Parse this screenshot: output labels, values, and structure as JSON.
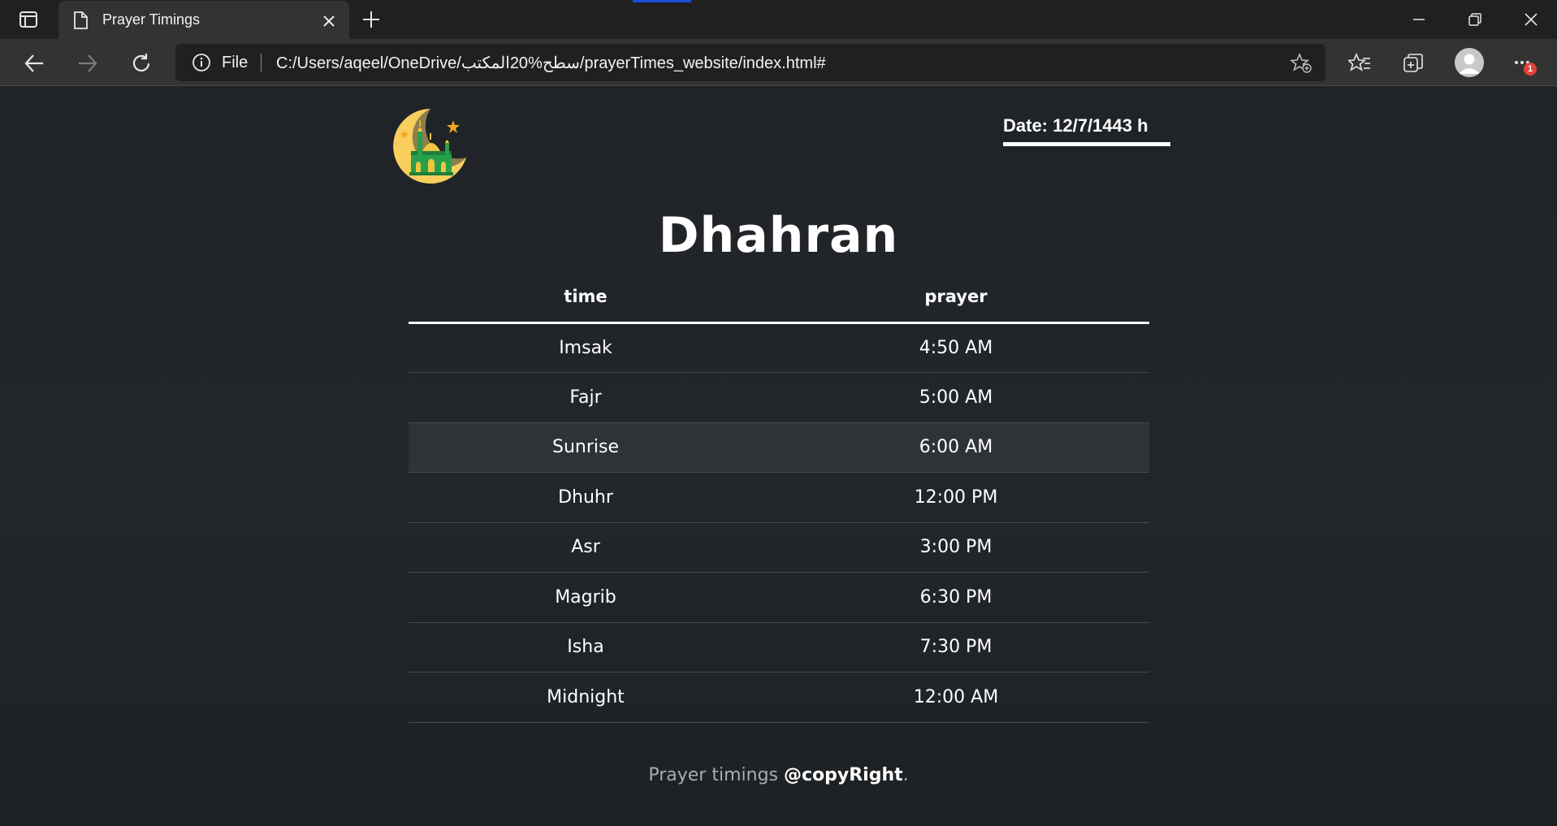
{
  "browser": {
    "tab_title": "Prayer Timings",
    "address_scheme": "File",
    "address_url": "C:/Users/aqeel/OneDrive/سطح%20المكتب/prayerTimes_website/index.html#",
    "menu_badge": "1"
  },
  "page": {
    "date_label": "Date: 12/7/1443 h",
    "city": "Dhahran",
    "table": {
      "headers": [
        "time",
        "prayer"
      ],
      "rows": [
        [
          "Imsak",
          "4:50 AM"
        ],
        [
          "Fajr",
          "5:00 AM"
        ],
        [
          "Sunrise",
          "6:00 AM"
        ],
        [
          "Dhuhr",
          "12:00 PM"
        ],
        [
          "Asr",
          "3:00 PM"
        ],
        [
          "Magrib",
          "6:30 PM"
        ],
        [
          "Isha",
          "7:30 PM"
        ],
        [
          "Midnight",
          "12:00 AM"
        ]
      ]
    },
    "footer_text": "Prayer timings ",
    "footer_bold": "@copyRight",
    "footer_end": "."
  },
  "icons": {
    "tab_actions": "tab-actions-icon",
    "page": "page-icon",
    "close": "close-icon",
    "new_tab": "plus-icon",
    "back": "back-arrow-icon",
    "forward": "forward-arrow-icon",
    "refresh": "refresh-icon",
    "info": "info-icon",
    "add_favorite": "add-favorite-icon",
    "favorites": "favorites-icon",
    "collections": "collections-icon",
    "profile": "profile-avatar",
    "more": "more-icon"
  }
}
